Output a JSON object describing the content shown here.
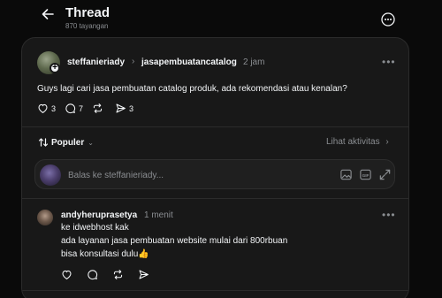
{
  "header": {
    "title": "Thread",
    "views": "870 tayangan",
    "back_icon": "arrow-left-icon",
    "more_icon": "more-circle-icon"
  },
  "post": {
    "username": "steffanieriady",
    "mention": "jasapembuatancatalog",
    "time": "2 jam",
    "text": "Guys lagi cari jasa pembuatan catalog produk, ada rekomendasi atau kenalan?",
    "likes": "3",
    "comments": "7",
    "reposts": "",
    "shares": "3"
  },
  "sort": {
    "label": "Populer",
    "activity_label": "Lihat aktivitas"
  },
  "reply": {
    "placeholder": "Balas ke steffanieriady..."
  },
  "comment": {
    "username": "andyheruprasetya",
    "time": "1 menit",
    "lines": [
      "ke idwebhost kak",
      "ada layanan jasa pembuatan website mulai dari 800rbuan",
      "bisa konsultasi dulu👍"
    ]
  },
  "colors": {
    "background": "#0a0a0a",
    "card": "#181818",
    "text": "#f3f5f7",
    "muted": "#8a8d91"
  }
}
